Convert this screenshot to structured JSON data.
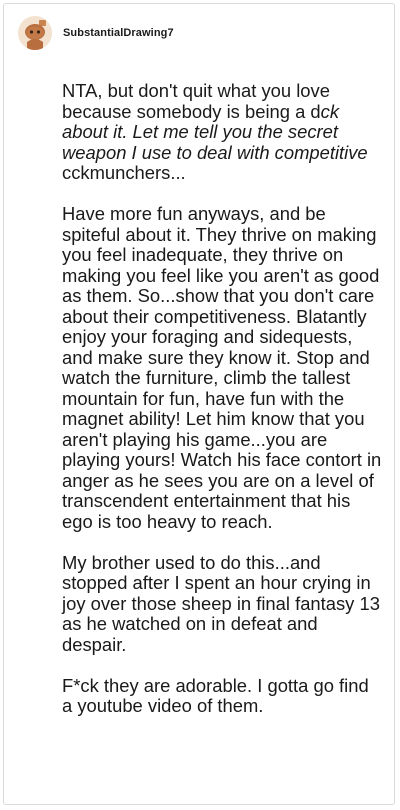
{
  "comment": {
    "username": "SubstantialDrawing7",
    "avatar_icon": "reddit-snoo-avatar-icon",
    "paragraphs": [
      {
        "line1": "NTA, but don't quit what you love because somebody is being a d",
        "italic": "ck about it. Let me tell you the secret weapon I use to deal with competitive ",
        "line3": "cckmunchers..."
      },
      "Have more fun anyways, and be spiteful about it. They thrive on making you feel inadequate, they thrive on making you feel like you aren't as good as them. So...show that you don't care about their competitiveness. Blatantly enjoy your foraging and sidequests, and make sure they know it. Stop and watch the furniture, climb the tallest mountain for fun, have fun with the magnet ability! Let him know that you aren't playing his game...you are playing yours! Watch his face contort in anger as he sees you are on a level of transcendent entertainment that his ego is too heavy to reach.",
      "My brother used to do this...and stopped after I spent an hour crying in joy over those sheep in final fantasy 13 as he watched on in defeat and despair.",
      "F*ck they are adorable. I gotta go find a youtube video of them."
    ]
  }
}
